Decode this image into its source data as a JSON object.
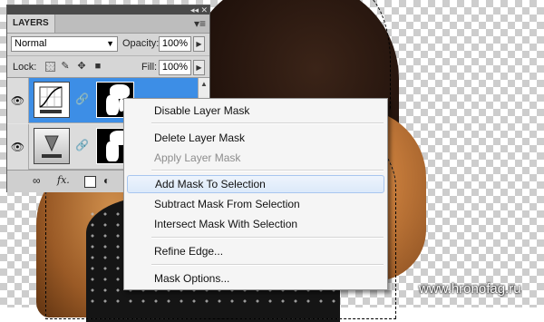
{
  "watermark": "www.hronofag.ru",
  "layers_panel": {
    "tab_label": "LAYERS",
    "collapse_glyph": "◂◂",
    "close_glyph": "✕",
    "menu_glyph": "▾≡",
    "blend_mode": "Normal",
    "opacity_label": "Opacity:",
    "opacity_value": "100%",
    "lock_label": "Lock:",
    "fill_label": "Fill:",
    "fill_value": "100%",
    "layers": [
      {
        "thumb_icon": "curves-adjustment-icon",
        "has_mask": true,
        "selected": true,
        "visible": true
      },
      {
        "thumb_icon": "gradient-adjustment-icon",
        "has_mask": true,
        "selected": false,
        "visible": true
      }
    ],
    "footer_icons": [
      "link-icon",
      "fx-icon",
      "add-mask-icon",
      "adjustment-layer-icon"
    ],
    "footer_fx_text": "fx."
  },
  "context_menu": {
    "items": [
      {
        "label": "Disable Layer Mask",
        "disabled": false
      },
      {
        "label": "Delete Layer Mask",
        "disabled": false
      },
      {
        "label": "Apply Layer Mask",
        "disabled": true
      },
      {
        "label": "Add Mask To Selection",
        "disabled": false,
        "highlighted": true
      },
      {
        "label": "Subtract Mask From Selection",
        "disabled": false
      },
      {
        "label": "Intersect Mask With Selection",
        "disabled": false
      },
      {
        "label": "Refine Edge...",
        "disabled": false
      },
      {
        "label": "Mask Options...",
        "disabled": false
      }
    ]
  },
  "colors": {
    "selected_layer": "#3d8ee6",
    "menu_highlight_border": "#a8c6ef",
    "panel_bg": "#d6d6d6"
  }
}
